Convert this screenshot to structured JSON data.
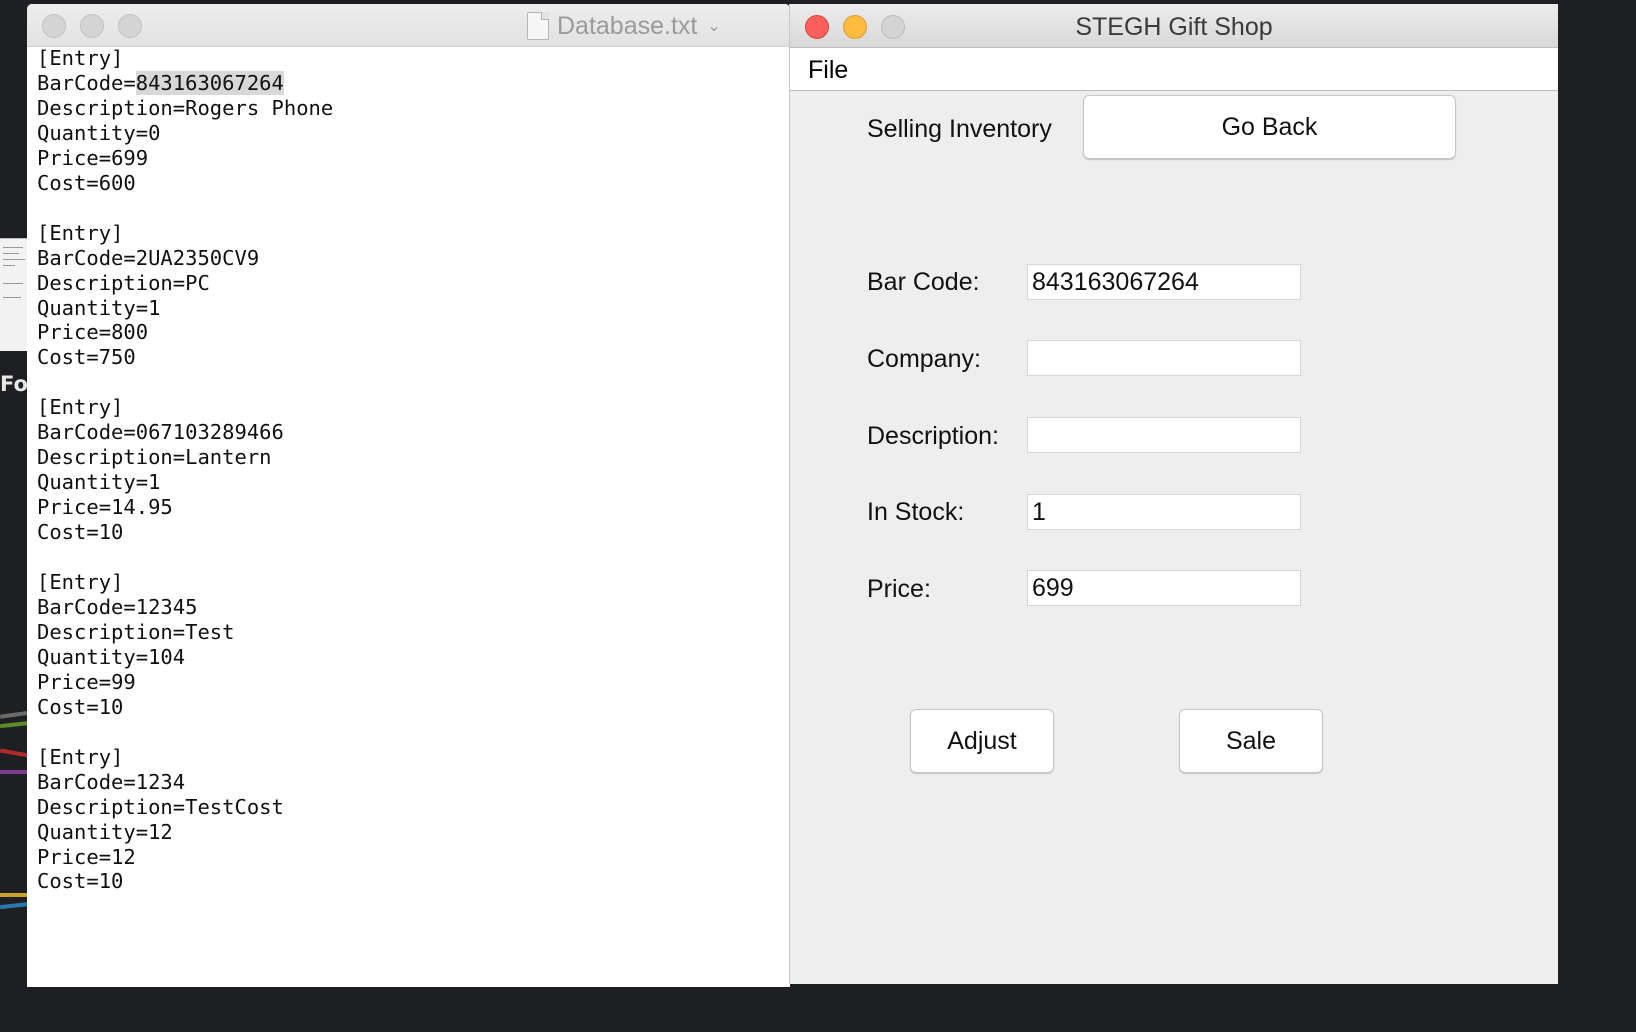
{
  "desktop": {
    "partial_label": "For"
  },
  "editor": {
    "title": "Database.txt",
    "highlighted_barcode": "843163067264",
    "entries": [
      {
        "header": "[Entry]",
        "barcode": "843163067264",
        "description": "Rogers Phone",
        "quantity": "0",
        "price": "699",
        "cost": "600"
      },
      {
        "header": "[Entry]",
        "barcode": "2UA2350CV9",
        "description": "PC",
        "quantity": "1",
        "price": "800",
        "cost": "750"
      },
      {
        "header": "[Entry]",
        "barcode": "067103289466",
        "description": "Lantern",
        "quantity": "1",
        "price": "14.95",
        "cost": "10"
      },
      {
        "header": "[Entry]",
        "barcode": "12345",
        "description": "Test",
        "quantity": "104",
        "price": "99",
        "cost": "10"
      },
      {
        "header": "[Entry]",
        "barcode": "1234",
        "description": "TestCost",
        "quantity": "12",
        "price": "12",
        "cost": "10"
      }
    ]
  },
  "app": {
    "title": "STEGH Gift Shop",
    "menu": {
      "file": "File"
    },
    "section_label": "Selling Inventory",
    "go_back": "Go Back",
    "fields": {
      "barcode": {
        "label": "Bar Code:",
        "value": "843163067264"
      },
      "company": {
        "label": "Company:",
        "value": ""
      },
      "description": {
        "label": "Description:",
        "value": ""
      },
      "in_stock": {
        "label": "In Stock:",
        "value": "1"
      },
      "price": {
        "label": "Price:",
        "value": "699"
      }
    },
    "buttons": {
      "adjust": "Adjust",
      "sale": "Sale"
    }
  },
  "colors": {
    "close": "#fc605c",
    "minimize": "#fdbc40",
    "zoom_inactive": "#d4d4d4",
    "app_background": "#eeeeee",
    "selection": "#d8d8d8"
  }
}
